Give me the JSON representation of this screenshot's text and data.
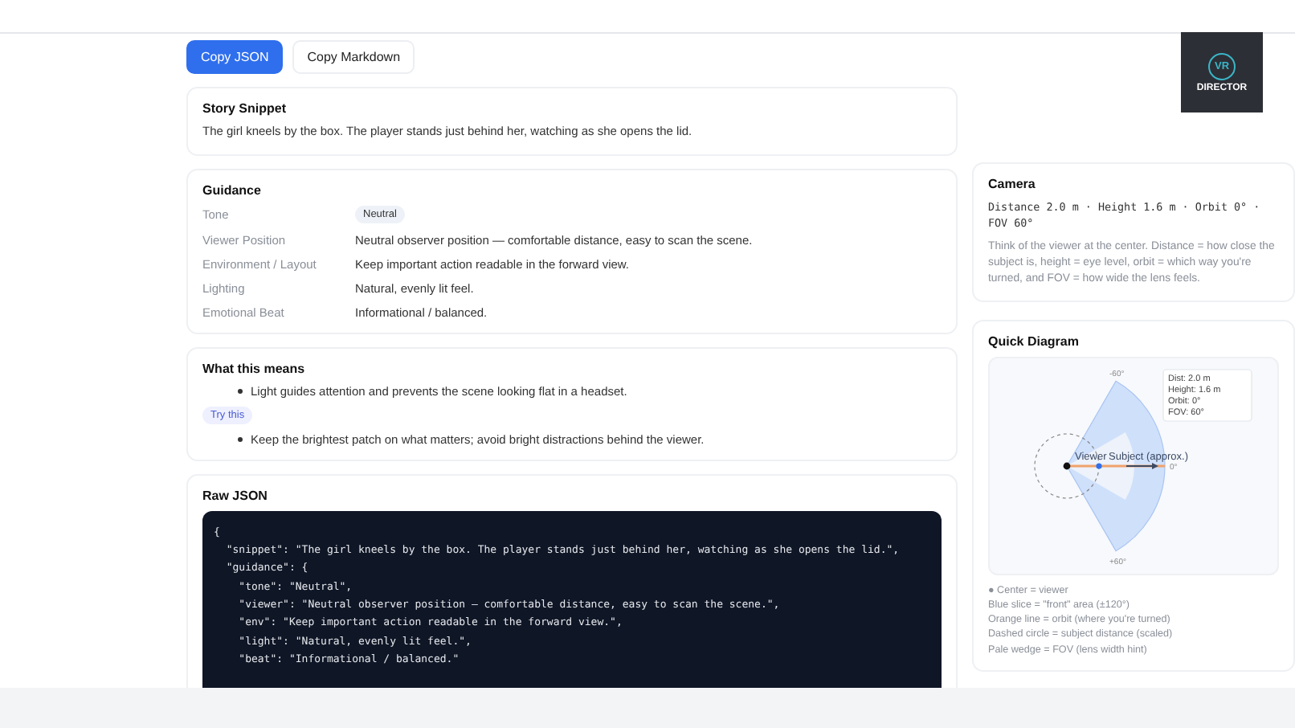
{
  "logo": {
    "badge": "VR",
    "name": "DIRECTOR"
  },
  "actions": [
    {
      "label": "Copy JSON",
      "selected": true
    },
    {
      "label": "Copy Markdown",
      "selected": false
    }
  ],
  "story": {
    "title": "Story Snippet",
    "text": "The girl kneels by the box. The player stands just behind her, watching as she opens the lid."
  },
  "guidance": {
    "title": "Guidance",
    "rows": [
      {
        "label": "Tone",
        "value": "Neutral",
        "kind": "chip"
      },
      {
        "label": "Viewer Position",
        "value": "Neutral observer position — comfortable distance, easy to scan the scene.",
        "kind": "text"
      },
      {
        "label": "Environment / Layout",
        "value": "Keep important action readable in the forward view.",
        "kind": "text"
      },
      {
        "label": "Lighting",
        "value": "Natural, evenly lit feel.",
        "kind": "text"
      },
      {
        "label": "Emotional Beat",
        "value": "Informational / balanced.",
        "kind": "text"
      }
    ]
  },
  "meaning": {
    "title": "What this means",
    "points": [
      "Light guides attention and prevents the scene looking flat in a headset."
    ],
    "tip_label": "Try this",
    "tips": [
      "Keep the brightest patch on what matters; avoid bright distractions behind the viewer."
    ]
  },
  "raw_json": {
    "title": "Raw JSON",
    "lines": [
      "{",
      "  \"snippet\": \"The girl kneels by the box. The player stands just behind her, watching as she opens the lid.\",",
      "  \"guidance\": {",
      "    \"tone\": \"Neutral\",",
      "    \"viewer\": \"Neutral observer position — comfortable distance, easy to scan the scene.\",",
      "    \"env\": \"Keep important action readable in the forward view.\",",
      "    \"light\": \"Natural, evenly lit feel.\",",
      "    \"beat\": \"Informational / balanced.\""
    ]
  },
  "camera": {
    "title": "Camera",
    "settings": "Distance 2.0 m · Height 1.6 m · Orbit 0° · FOV 60°",
    "note": "Think of the viewer at the center. Distance = how close the subject is, height = eye level, orbit = which way you're turned, and FOV = how wide the lens feels."
  },
  "diagram": {
    "title": "Quick Diagram",
    "angle_top": "-60°",
    "angle_bottom": "+60°",
    "angle_front": "0°",
    "viewer_label": "Viewer",
    "subject_label": "Subject (approx.)",
    "info": [
      "Dist: 2.0 m",
      "Height: 1.6 m",
      "Orbit: 0°",
      "FOV: 60°"
    ],
    "legend": [
      "● Center = viewer",
      "Blue slice = \"front\" area (±120°)",
      "Orange line = orbit (where you're turned)",
      "Dashed circle = subject distance (scaled)",
      "Pale wedge = FOV (lens width hint)"
    ]
  }
}
